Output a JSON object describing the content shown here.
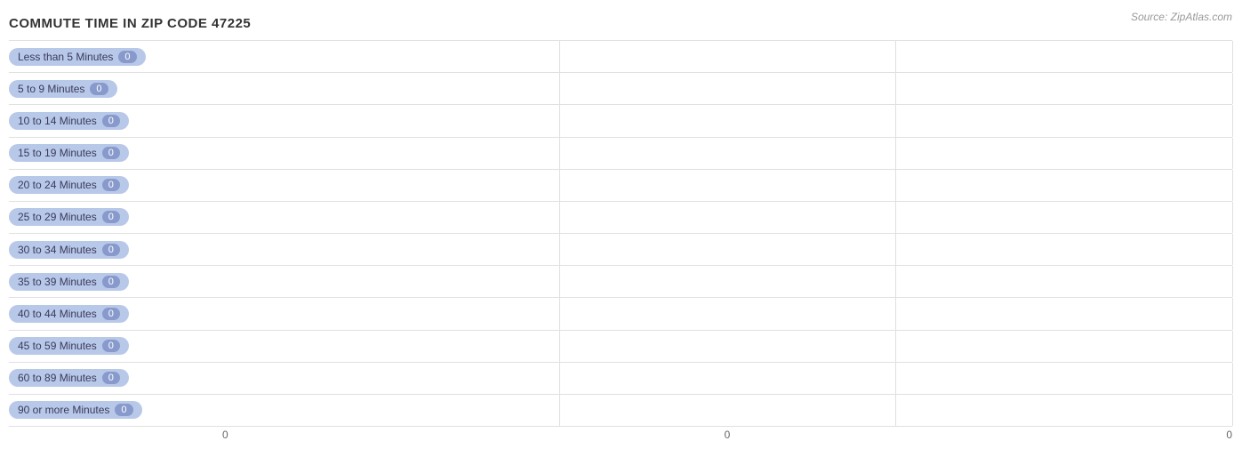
{
  "title": "COMMUTE TIME IN ZIP CODE 47225",
  "source": "Source: ZipAtlas.com",
  "bars": [
    {
      "label": "Less than 5 Minutes",
      "value": 0
    },
    {
      "label": "5 to 9 Minutes",
      "value": 0
    },
    {
      "label": "10 to 14 Minutes",
      "value": 0
    },
    {
      "label": "15 to 19 Minutes",
      "value": 0
    },
    {
      "label": "20 to 24 Minutes",
      "value": 0
    },
    {
      "label": "25 to 29 Minutes",
      "value": 0
    },
    {
      "label": "30 to 34 Minutes",
      "value": 0
    },
    {
      "label": "35 to 39 Minutes",
      "value": 0
    },
    {
      "label": "40 to 44 Minutes",
      "value": 0
    },
    {
      "label": "45 to 59 Minutes",
      "value": 0
    },
    {
      "label": "60 to 89 Minutes",
      "value": 0
    },
    {
      "label": "90 or more Minutes",
      "value": 0
    }
  ],
  "x_ticks": [
    "0",
    "0",
    "0"
  ],
  "pill_value_label": "0"
}
